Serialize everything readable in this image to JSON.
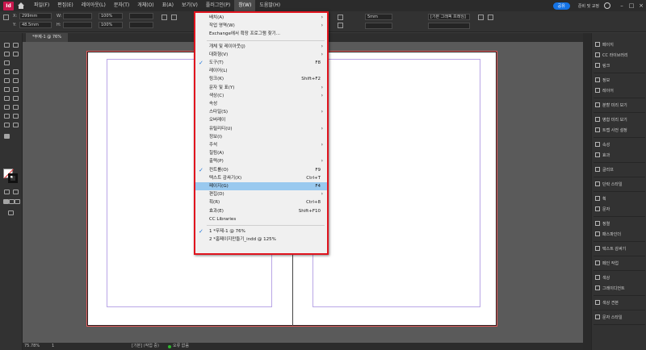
{
  "menubar": {
    "logo": "Id",
    "items": [
      "파일(F)",
      "편집(E)",
      "레이아웃(L)",
      "문자(T)",
      "개체(O)",
      "표(A)",
      "보기(V)",
      "플러그인(P)",
      "창(W)",
      "도움말(H)"
    ],
    "share_label": "공유",
    "workspace_label": "준비 및 교정",
    "accent_color": "#c8184d",
    "share_color": "#1473e6"
  },
  "controlbar": {
    "x_label": "X:",
    "y_label": "Y:",
    "w_label": "W:",
    "h_label": "H:",
    "x_value": "299mm",
    "y_value": "48.5mm",
    "zoom_value": "100%",
    "stroke_value": "5mm",
    "style_value": "[기본 그래픽 프레임]"
  },
  "document": {
    "tab_label": "*무제-1 @ 76%"
  },
  "window_menu": {
    "highlight_color": "#99c9ef",
    "border_color": "#e0141e",
    "rows": [
      {
        "label": "배치(A)",
        "shortcut": "",
        "submenu": true,
        "checked": false,
        "highlight": false
      },
      {
        "label": "작업 영역(W)",
        "shortcut": "",
        "submenu": true,
        "checked": false,
        "highlight": false
      },
      {
        "label": "Exchange에서 확장 프로그램 찾기...",
        "shortcut": "",
        "submenu": false,
        "checked": false,
        "highlight": false
      },
      {
        "sep": true
      },
      {
        "label": "개체 및 레이아웃(J)",
        "shortcut": "",
        "submenu": true,
        "checked": false,
        "highlight": false
      },
      {
        "label": "대화형(V)",
        "shortcut": "",
        "submenu": true,
        "checked": false,
        "highlight": false
      },
      {
        "label": "도구(T)",
        "shortcut": "F8",
        "submenu": false,
        "checked": true,
        "highlight": false
      },
      {
        "label": "레이어(L)",
        "shortcut": "",
        "submenu": false,
        "checked": false,
        "highlight": false
      },
      {
        "label": "링크(K)",
        "shortcut": "Shift+F2",
        "submenu": false,
        "checked": false,
        "highlight": false
      },
      {
        "label": "문자 및 표(Y)",
        "shortcut": "",
        "submenu": true,
        "checked": false,
        "highlight": false
      },
      {
        "label": "색상(C)",
        "shortcut": "",
        "submenu": true,
        "checked": false,
        "highlight": false
      },
      {
        "label": "속성",
        "shortcut": "",
        "submenu": false,
        "checked": false,
        "highlight": false
      },
      {
        "label": "스타일(S)",
        "shortcut": "",
        "submenu": true,
        "checked": false,
        "highlight": false
      },
      {
        "label": "오버레이",
        "shortcut": "",
        "submenu": false,
        "checked": false,
        "highlight": false
      },
      {
        "label": "유틸리티(U)",
        "shortcut": "",
        "submenu": true,
        "checked": false,
        "highlight": false
      },
      {
        "label": "정보(I)",
        "shortcut": "",
        "submenu": false,
        "checked": false,
        "highlight": false
      },
      {
        "label": "주석",
        "shortcut": "",
        "submenu": true,
        "checked": false,
        "highlight": false
      },
      {
        "label": "칠됨(A)",
        "shortcut": "",
        "submenu": false,
        "checked": false,
        "highlight": false
      },
      {
        "label": "출력(P)",
        "shortcut": "",
        "submenu": true,
        "checked": false,
        "highlight": false
      },
      {
        "label": "컨트롤(O)",
        "shortcut": "F9",
        "submenu": false,
        "checked": true,
        "highlight": false
      },
      {
        "label": "텍스트 감싸기(X)",
        "shortcut": "Ctrl+T",
        "submenu": false,
        "checked": false,
        "highlight": false
      },
      {
        "label": "페이지(G)",
        "shortcut": "F4",
        "submenu": false,
        "checked": false,
        "highlight": true
      },
      {
        "label": "편집(D)",
        "shortcut": "",
        "submenu": true,
        "checked": false,
        "highlight": false
      },
      {
        "label": "획(R)",
        "shortcut": "Ctrl+8",
        "submenu": false,
        "checked": false,
        "highlight": false
      },
      {
        "label": "효과(E)",
        "shortcut": "Shift+F10",
        "submenu": false,
        "checked": false,
        "highlight": false
      },
      {
        "label": "CC Libraries",
        "shortcut": "",
        "submenu": false,
        "checked": false,
        "highlight": false
      },
      {
        "sep": true
      },
      {
        "label": "1 *무제-1 @ 76%",
        "shortcut": "",
        "submenu": false,
        "checked": true,
        "highlight": false
      },
      {
        "label": "2 *홈페이지만들기_indd @ 125%",
        "shortcut": "",
        "submenu": false,
        "checked": false,
        "highlight": false
      }
    ]
  },
  "right_panel": {
    "groups": [
      [
        {
          "icon": "pages-icon",
          "label": "페이지"
        },
        {
          "icon": "cc-libraries-icon",
          "label": "CC 라이브러리"
        },
        {
          "icon": "link-icon",
          "label": "링크"
        }
      ],
      [
        {
          "icon": "info-icon",
          "label": "정보"
        },
        {
          "icon": "layers-icon",
          "label": "레이어"
        }
      ],
      [
        {
          "icon": "split-view-icon",
          "label": "분할 미리 보기"
        }
      ],
      [
        {
          "icon": "split-view-icon",
          "label": "병합 미리 보기"
        },
        {
          "icon": "trim-view-icon",
          "label": "트랩 사전 설정"
        }
      ],
      [
        {
          "icon": "attributes-icon",
          "label": "속성"
        },
        {
          "icon": "effects-icon",
          "label": "효과"
        }
      ],
      [
        {
          "icon": "glyph-icon",
          "label": "글리프"
        }
      ],
      [
        {
          "icon": "paragraph-style-icon",
          "label": "단락 스타일"
        }
      ],
      [
        {
          "icon": "stroke-icon",
          "label": "획"
        },
        {
          "icon": "character-icon",
          "label": "문자"
        }
      ],
      [
        {
          "icon": "align-icon",
          "label": "정렬"
        },
        {
          "icon": "pathfinder-icon",
          "label": "패스파인더"
        }
      ],
      [
        {
          "icon": "text-wrap-icon",
          "label": "텍스트 감싸기"
        }
      ],
      [
        {
          "icon": "links-icon",
          "label": "페인 작업"
        }
      ],
      [
        {
          "icon": "color-icon",
          "label": "색상"
        },
        {
          "icon": "gradient-icon",
          "label": "그레이디언트"
        }
      ],
      [
        {
          "icon": "swatches-icon",
          "label": "색상 견본"
        }
      ],
      [
        {
          "icon": "character-style-icon",
          "label": "문자 스타일"
        }
      ]
    ]
  },
  "statusbar": {
    "zoom": "75.78%",
    "page": "1",
    "master": "[기본] (작업 중)",
    "errors": "오류 없음"
  }
}
